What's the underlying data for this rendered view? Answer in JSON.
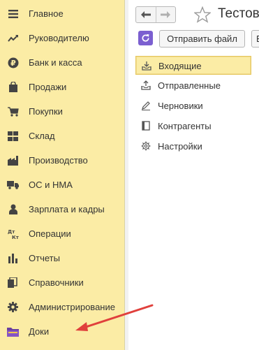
{
  "sidebar": {
    "items": [
      {
        "label": "Главное",
        "icon": "menu-icon"
      },
      {
        "label": "Руководителю",
        "icon": "trend-icon"
      },
      {
        "label": "Банк и касса",
        "icon": "ruble-icon"
      },
      {
        "label": "Продажи",
        "icon": "shopping-bag-icon"
      },
      {
        "label": "Покупки",
        "icon": "cart-icon"
      },
      {
        "label": "Склад",
        "icon": "warehouse-icon"
      },
      {
        "label": "Производство",
        "icon": "factory-icon"
      },
      {
        "label": "ОС и НМА",
        "icon": "truck-icon"
      },
      {
        "label": "Зарплата и кадры",
        "icon": "person-icon"
      },
      {
        "label": "Операции",
        "icon": "debit-credit-icon"
      },
      {
        "label": "Отчеты",
        "icon": "bar-chart-icon"
      },
      {
        "label": "Справочники",
        "icon": "books-icon"
      },
      {
        "label": "Администрирование",
        "icon": "gear-icon"
      },
      {
        "label": "Доки",
        "icon": "folder-icon"
      }
    ]
  },
  "header": {
    "title": "Тестов"
  },
  "toolbar": {
    "send_label": "Отправить файл",
    "cut_label": "В"
  },
  "folders": {
    "items": [
      {
        "label": "Входящие",
        "icon": "inbox-icon",
        "selected": true
      },
      {
        "label": "Отправленные",
        "icon": "outbox-icon",
        "selected": false
      },
      {
        "label": "Черновики",
        "icon": "pencil-icon",
        "selected": false
      },
      {
        "label": "Контрагенты",
        "icon": "contacts-icon",
        "selected": false
      },
      {
        "label": "Настройки",
        "icon": "settings-icon",
        "selected": false
      }
    ]
  },
  "colors": {
    "sidebar_bg": "#fbeca5",
    "selected_border": "#e5c65a",
    "accent_purple": "#7b5fd0",
    "annotation_arrow": "#e0403c"
  }
}
